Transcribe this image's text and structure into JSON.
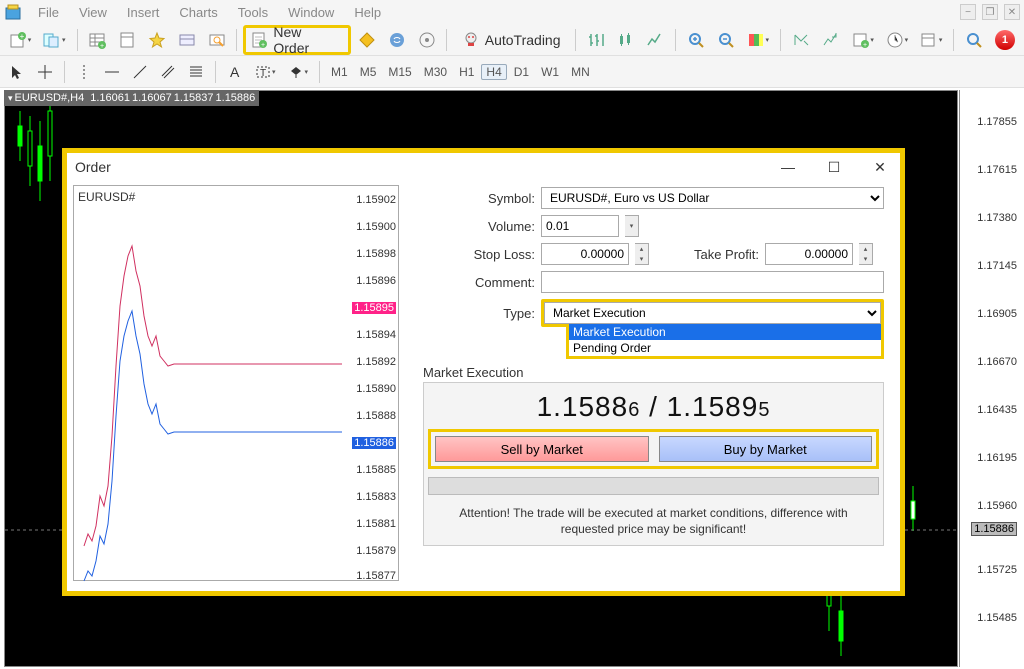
{
  "menubar": {
    "items": [
      "File",
      "View",
      "Insert",
      "Charts",
      "Tools",
      "Window",
      "Help"
    ]
  },
  "toolbar": {
    "new_order_label": "New Order",
    "autotrading_label": "AutoTrading",
    "notif_count": "1"
  },
  "timeframes": [
    "M1",
    "M5",
    "M15",
    "M30",
    "H1",
    "H4",
    "D1",
    "W1",
    "MN"
  ],
  "active_timeframe": "H4",
  "chart_header": {
    "symbol": "EURUSD#,H4",
    "prices": [
      "1.16061",
      "1.16067",
      "1.15837",
      "1.15886"
    ]
  },
  "main_price_scale": [
    "1.17855",
    "1.17615",
    "1.17380",
    "1.17145",
    "1.16905",
    "1.16670",
    "1.16435",
    "1.16195",
    "1.15960",
    "1.15886",
    "1.15725",
    "1.15485"
  ],
  "main_price_highlight_index": 9,
  "dialog": {
    "title": "Order",
    "mini_chart_title": "EURUSD#",
    "mini_scale": [
      "1.15902",
      "1.15900",
      "1.15898",
      "1.15896",
      "1.15895",
      "1.15894",
      "1.15892",
      "1.15890",
      "1.15888",
      "1.15886",
      "1.15885",
      "1.15883",
      "1.15881",
      "1.15879",
      "1.15877"
    ],
    "mini_hl_red_index": 4,
    "mini_hl_blue_index": 9,
    "labels": {
      "symbol": "Symbol:",
      "volume": "Volume:",
      "stop_loss": "Stop Loss:",
      "take_profit": "Take Profit:",
      "comment": "Comment:",
      "type": "Type:",
      "market_exec": "Market Execution"
    },
    "fields": {
      "symbol_value": "EURUSD#, Euro vs US Dollar",
      "volume_value": "0.01",
      "stop_loss_value": "0.00000",
      "take_profit_value": "0.00000",
      "comment_value": "",
      "type_value": "Market Execution"
    },
    "type_options": [
      "Market Execution",
      "Pending Order"
    ],
    "type_selected_index": 0,
    "big_price": {
      "sell_main": "1.1588",
      "sell_frac": "6",
      "sep": " / ",
      "buy_main": "1.1589",
      "buy_frac": "5"
    },
    "sell_label": "Sell by Market",
    "buy_label": "Buy by Market",
    "attention": "Attention! The trade will be executed at market conditions, difference with requested price may be significant!"
  }
}
